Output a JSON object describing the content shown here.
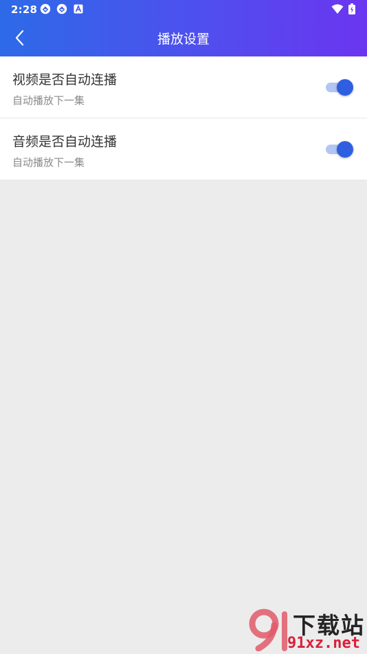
{
  "status_bar": {
    "time": "2:28",
    "notification_icons": [
      "sync-arrows-icon",
      "sync-arrows-icon",
      "a-box-icon"
    ],
    "right_icons": [
      "wifi-icon",
      "battery-charging-icon"
    ]
  },
  "header": {
    "title": "播放设置",
    "back_icon": "chevron-left-icon",
    "gradient_start": "#2d6ae8",
    "gradient_end": "#6b35f0"
  },
  "settings": [
    {
      "title": "视频是否自动连播",
      "description": "自动播放下一集",
      "enabled": true
    },
    {
      "title": "音频是否自动连播",
      "description": "自动播放下一集",
      "enabled": true
    }
  ],
  "colors": {
    "toggle_on": "#2f5fe0",
    "toggle_track": "#b3c6f3",
    "page_background": "#ececec"
  },
  "watermark": {
    "logo": "91",
    "brand": "下载站",
    "url": "91xz.net"
  }
}
